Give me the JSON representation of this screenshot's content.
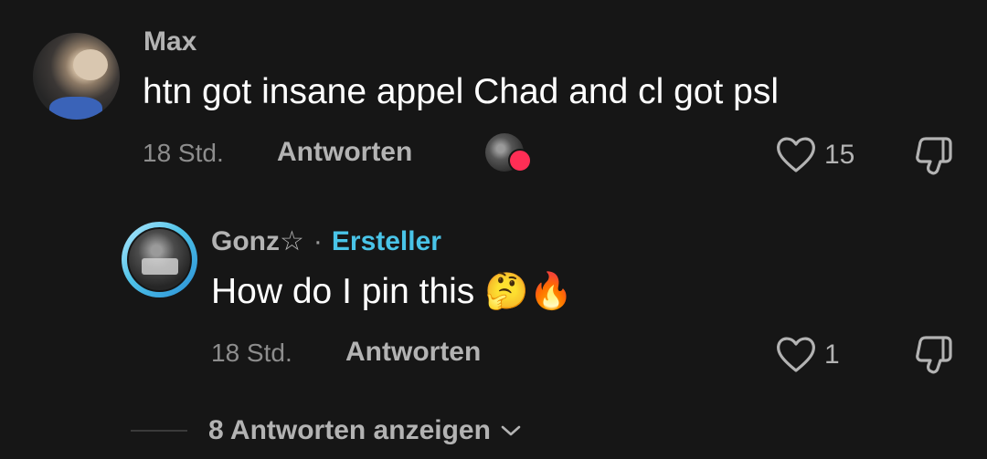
{
  "comments": [
    {
      "username": "Max",
      "text": "htn got insane appel Chad and cl got psl",
      "time": "18 Std.",
      "reply_label": "Antworten",
      "likes": "15"
    }
  ],
  "reply": {
    "username": "Gonz☆",
    "separator": "·",
    "creator_badge": "Ersteller",
    "text": "How do I pin this 🤔🔥",
    "time": "18 Std.",
    "reply_label": "Antworten",
    "likes": "1"
  },
  "show_replies_label": "8 Antworten anzeigen",
  "icons": {
    "like": "heart-outline-icon",
    "dislike": "thumbs-down-icon",
    "expand": "chevron-down-icon",
    "creator_liked": "creator-liked-heart-icon"
  },
  "colors": {
    "background": "#161616",
    "creator_accent": "#49c4e8",
    "liked_heart": "#ff2e55"
  }
}
